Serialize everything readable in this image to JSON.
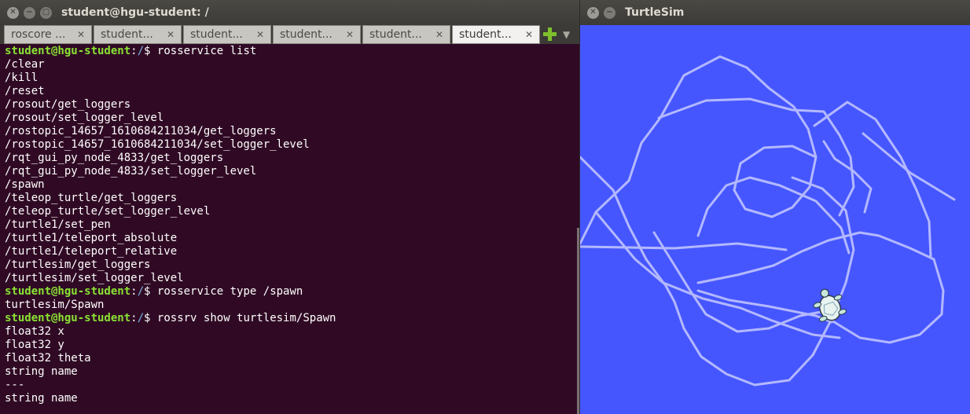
{
  "terminal": {
    "title": "student@hgu-student: /",
    "tabs": [
      {
        "label": "roscore ..."
      },
      {
        "label": "student..."
      },
      {
        "label": "student..."
      },
      {
        "label": "student..."
      },
      {
        "label": "student..."
      },
      {
        "label": "student...",
        "active": true
      }
    ],
    "prompt": {
      "user": "student@hgu-student",
      "path": "/",
      "sign": "$"
    },
    "lines": [
      {
        "type": "cmd",
        "text": "rosservice list"
      },
      {
        "type": "out",
        "text": "/clear"
      },
      {
        "type": "out",
        "text": "/kill"
      },
      {
        "type": "out",
        "text": "/reset"
      },
      {
        "type": "out",
        "text": "/rosout/get_loggers"
      },
      {
        "type": "out",
        "text": "/rosout/set_logger_level"
      },
      {
        "type": "out",
        "text": "/rostopic_14657_1610684211034/get_loggers"
      },
      {
        "type": "out",
        "text": "/rostopic_14657_1610684211034/set_logger_level"
      },
      {
        "type": "out",
        "text": "/rqt_gui_py_node_4833/get_loggers"
      },
      {
        "type": "out",
        "text": "/rqt_gui_py_node_4833/set_logger_level"
      },
      {
        "type": "out",
        "text": "/spawn"
      },
      {
        "type": "out",
        "text": "/teleop_turtle/get_loggers"
      },
      {
        "type": "out",
        "text": "/teleop_turtle/set_logger_level"
      },
      {
        "type": "out",
        "text": "/turtle1/set_pen"
      },
      {
        "type": "out",
        "text": "/turtle1/teleport_absolute"
      },
      {
        "type": "out",
        "text": "/turtle1/teleport_relative"
      },
      {
        "type": "out",
        "text": "/turtlesim/get_loggers"
      },
      {
        "type": "out",
        "text": "/turtlesim/set_logger_level"
      },
      {
        "type": "cmd",
        "text": "rosservice type /spawn"
      },
      {
        "type": "out",
        "text": "turtlesim/Spawn"
      },
      {
        "type": "cmd",
        "text": "rossrv show turtlesim/Spawn"
      },
      {
        "type": "out",
        "text": "float32 x"
      },
      {
        "type": "out",
        "text": "float32 y"
      },
      {
        "type": "out",
        "text": "float32 theta"
      },
      {
        "type": "out",
        "text": "string name"
      },
      {
        "type": "out",
        "text": "---"
      },
      {
        "type": "out",
        "text": "string name"
      }
    ],
    "colors": {
      "background": "#300a24",
      "prompt_user": "#8ae234",
      "prompt_path": "#729fcf"
    }
  },
  "turtlesim": {
    "title": "TurtleSim",
    "colors": {
      "background": "#4556ff",
      "trail": "#b3b8ff"
    }
  }
}
